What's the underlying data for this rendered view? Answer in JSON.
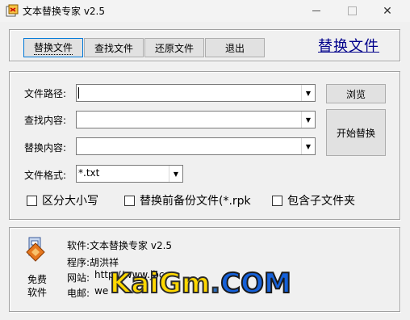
{
  "window": {
    "title": "文本替换专家 v2.5"
  },
  "toolbar": {
    "buttons": [
      {
        "label": "替换文件"
      },
      {
        "label": "查找文件"
      },
      {
        "label": "还原文件"
      },
      {
        "label": "退出"
      }
    ],
    "banner": "替换文件"
  },
  "form": {
    "path_label": "文件路径:",
    "find_label": "查找内容:",
    "replace_label": "替换内容:",
    "format_label": "文件格式:",
    "format_value": "*.txt",
    "path_value": "",
    "find_value": "",
    "replace_value": ""
  },
  "actions": {
    "browse": "浏览",
    "start": "开始替换"
  },
  "options": [
    {
      "label": "区分大小写",
      "checked": false
    },
    {
      "label": "替换前备份文件(*.rpk",
      "checked": false
    },
    {
      "label": "包含子文件夹",
      "checked": false
    }
  ],
  "about": {
    "icon_caption_1": "免费",
    "icon_caption_2": "软件",
    "software": "软件:文本替换专家 v2.5",
    "author": "程序:胡洪祥",
    "site_label": "网站:",
    "site_value": "http://www.jbc",
    "email_label": "电邮:",
    "email_value": "we"
  },
  "watermark": {
    "part1": "KaiGm",
    "part2": ".",
    "part3": "COM"
  },
  "colors": {
    "banner": "#00008b",
    "link": "#0000cc",
    "watermark": "#ffd800"
  }
}
